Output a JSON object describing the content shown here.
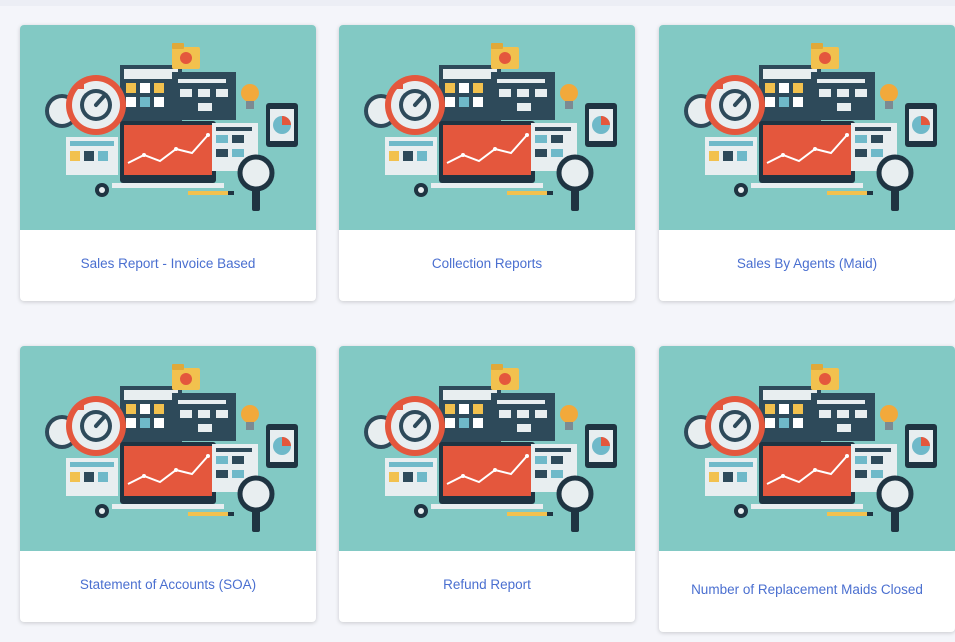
{
  "reports": [
    {
      "label": "Sales Report - Invoice Based"
    },
    {
      "label": "Collection Reports"
    },
    {
      "label": "Sales By Agents (Maid)"
    },
    {
      "label": "Statement of Accounts (SOA)"
    },
    {
      "label": "Refund Report"
    },
    {
      "label": "Number of Replacement Maids Closed"
    }
  ],
  "colors": {
    "thumbnail_bg": "#82c9c4",
    "label_text": "#4a6fd0",
    "page_bg": "#f4f5fa"
  },
  "icons": [
    "analytics-illustration"
  ]
}
